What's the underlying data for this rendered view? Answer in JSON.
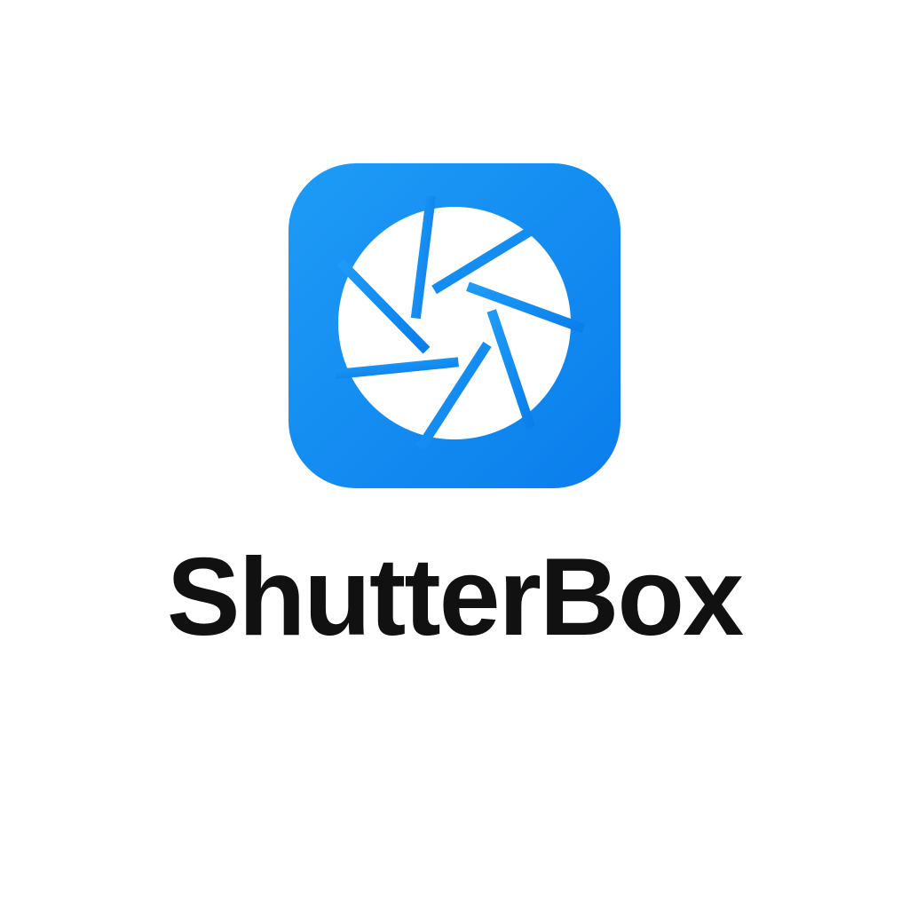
{
  "brand": {
    "name": "ShutterBox",
    "icon": "camera-aperture-icon",
    "colors": {
      "gradient_start": "#1E9BF6",
      "gradient_end": "#0A7EEC",
      "aperture_fill": "#FFFFFF",
      "wordmark": "#111111",
      "background": "#FFFFFF"
    }
  }
}
